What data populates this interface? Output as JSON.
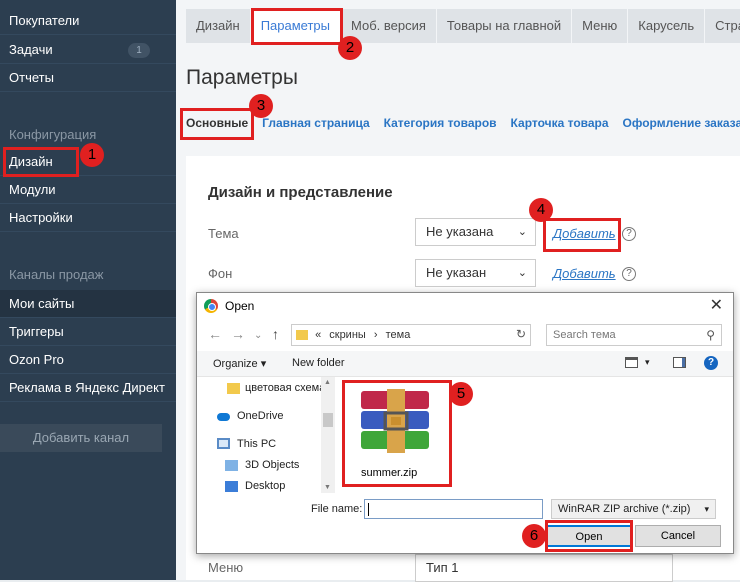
{
  "sidebar": {
    "items": [
      {
        "label": "Покупатели"
      },
      {
        "label": "Задачи",
        "badge": "1"
      },
      {
        "label": "Отчеты"
      }
    ],
    "section_config": "Конфигурация",
    "config_items": [
      {
        "label": "Дизайн"
      },
      {
        "label": "Модули"
      },
      {
        "label": "Настройки"
      }
    ],
    "section_channels": "Каналы продаж",
    "channel_items": [
      {
        "label": "Мои сайты"
      },
      {
        "label": "Триггеры"
      },
      {
        "label": "Ozon Pro"
      },
      {
        "label": "Реклама в Яндекс Директ"
      }
    ],
    "add_channel": "Добавить канал"
  },
  "tabs": [
    "Дизайн",
    "Параметры",
    "Моб. версия",
    "Товары на главной",
    "Меню",
    "Карусель",
    "Стран"
  ],
  "page_title": "Параметры",
  "subtabs": [
    "Основные",
    "Главная страница",
    "Категория товаров",
    "Карточка товара",
    "Оформление заказа"
  ],
  "panel": {
    "title": "Дизайн и представление",
    "rows": [
      {
        "label": "Тема",
        "value": "Не указана",
        "action": "Добавить"
      },
      {
        "label": "Фон",
        "value": "Не указан",
        "action": "Добавить"
      }
    ],
    "bottom_row": {
      "label": "Меню",
      "value": "Тип 1"
    }
  },
  "dialog": {
    "title": "Open",
    "breadcrumb": [
      "«",
      "скрины",
      "›",
      "тема"
    ],
    "search_placeholder": "Search тема",
    "organize": "Organize",
    "new_folder": "New folder",
    "tree": [
      "цветовая схема",
      "OneDrive",
      "This PC",
      "3D Objects",
      "Desktop"
    ],
    "file": {
      "name": "summer.zip"
    },
    "filename_label": "File name:",
    "filename_value": "",
    "filetype": "WinRAR ZIP archive (*.zip)",
    "open_button": "Open",
    "cancel_button": "Cancel"
  },
  "annotations": [
    "1",
    "2",
    "3",
    "4",
    "5",
    "6"
  ],
  "colors": {
    "annotation": "#e02020",
    "link": "#2a75c4",
    "sidebar": "#2c3e50"
  }
}
